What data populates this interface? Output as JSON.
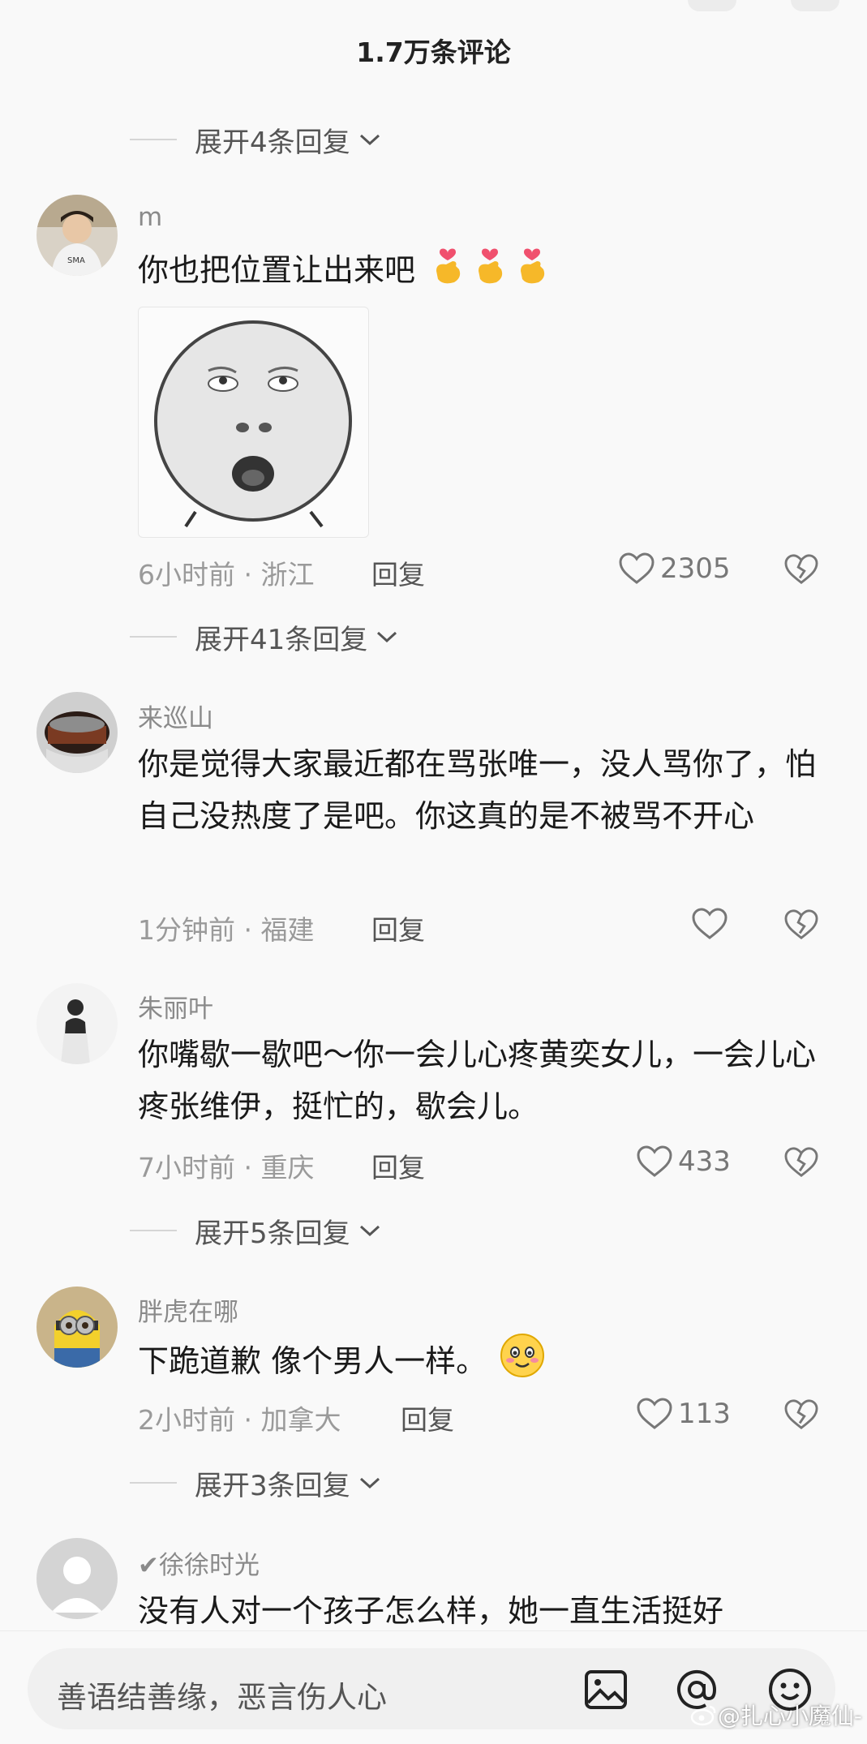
{
  "header": {
    "title": "1.7万条评论"
  },
  "expands": [
    "展开4条回复",
    "展开41条回复",
    "展开5条回复",
    "展开3条回复"
  ],
  "comments": [
    {
      "user": "m",
      "text": "你也把位置让出来吧",
      "time": "6小时前 · 浙江",
      "reply": "回复",
      "likes": "2305",
      "avatar_color": "#d9d2c6",
      "emoji": "finger-heart-icon"
    },
    {
      "user": "来巡山",
      "text": "你是觉得大家最近都在骂张唯一，没人骂你了，怕自己没热度了是吧。你这真的是不被骂不开心",
      "time": "1分钟前 · 福建",
      "reply": "回复",
      "likes": "",
      "avatar_color": "#7a5a4a"
    },
    {
      "user": "朱丽叶",
      "text": "你嘴歇一歇吧～你一会儿心疼黄奕女儿，一会儿心疼张维伊，挺忙的，歇会儿。",
      "time": "7小时前 · 重庆",
      "reply": "回复",
      "likes": "433",
      "avatar_color": "#eeeeee"
    },
    {
      "user": "胖虎在哪",
      "text": "下跪道歉 像个男人一样。",
      "time": "2小时前 · 加拿大",
      "reply": "回复",
      "likes": "113",
      "avatar_color": "#c9b48a",
      "emoji": "blush-smile-icon"
    },
    {
      "user": "✔徐徐时光",
      "text": "没有人对一个孩子怎么样，她一直生活挺好",
      "avatar_color": "#cfcfcf"
    }
  ],
  "input": {
    "placeholder": "善语结善缘，恶言伤人心"
  },
  "watermark": "@扎心小魔仙-",
  "colors": {
    "background": "#f9f9f9",
    "username": "#8a8a8a",
    "meta": "#9a9a9a",
    "emoji_heart": "#f0506e",
    "emoji_hand": "#f6b829"
  }
}
